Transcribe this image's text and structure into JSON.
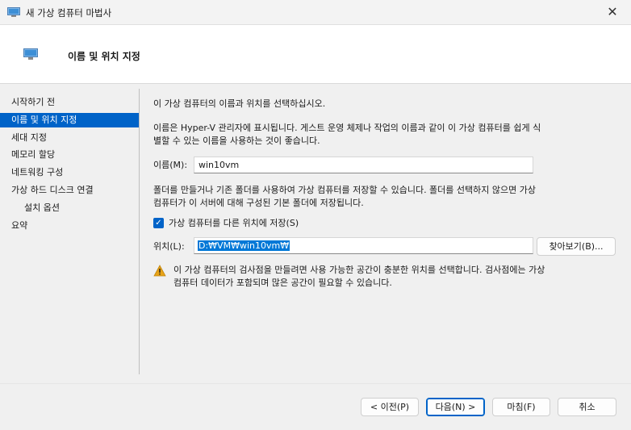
{
  "window": {
    "title": "새 가상 컴퓨터 마법사",
    "close_glyph": "✕"
  },
  "header": {
    "title": "이름 및 위치 지정"
  },
  "nav": {
    "items": [
      {
        "label": "시작하기 전"
      },
      {
        "label": "이름 및 위치 지정"
      },
      {
        "label": "세대 지정"
      },
      {
        "label": "메모리 할당"
      },
      {
        "label": "네트워킹 구성"
      },
      {
        "label": "가상 하드 디스크 연결"
      },
      {
        "label": "설치 옵션"
      },
      {
        "label": "요약"
      }
    ],
    "selected_index": 1
  },
  "content": {
    "intro": "이 가상 컴퓨터의 이름과 위치를 선택하십시오.",
    "name_desc_line1": "이름은 Hyper-V 관리자에 표시됩니다. 게스트 운영 체제나 작업의 이름과 같이 이 가상 컴퓨터를 쉽게 식",
    "name_desc_line2": "별할 수 있는 이름을 사용하는 것이 좋습니다.",
    "name_label": "이름(M):",
    "name_value": "win10vm",
    "folder_desc_line1": "폴더를 만들거나 기존 폴더를 사용하여 가상 컴퓨터를 저장할 수 있습니다. 폴더를 선택하지 않으면 가상",
    "folder_desc_line2": "컴퓨터가 이 서버에 대해 구성된 기본 폴더에 저장됩니다.",
    "store_checkbox_label": "가상 컴퓨터를 다른 위치에 저장(S)",
    "store_checkbox_checked": true,
    "location_label": "위치(L):",
    "location_value": "D:₩VM₩win10vm₩",
    "browse_button": "찾아보기(B)...",
    "warning_line1": "이 가상 컴퓨터의 검사점을 만들려면 사용 가능한 공간이 충분한 위치를 선택합니다. 검사점에는 가상",
    "warning_line2": "컴퓨터 데이터가 포함되며 많은 공간이 필요할 수 있습니다."
  },
  "footer": {
    "prev_button": "< 이전(P)",
    "next_button": "다음(N) >",
    "finish_button": "마침(F)",
    "cancel_button": "취소"
  },
  "colors": {
    "accent": "#0063c8",
    "selection": "#0078d7",
    "warning": "#e8a317"
  }
}
